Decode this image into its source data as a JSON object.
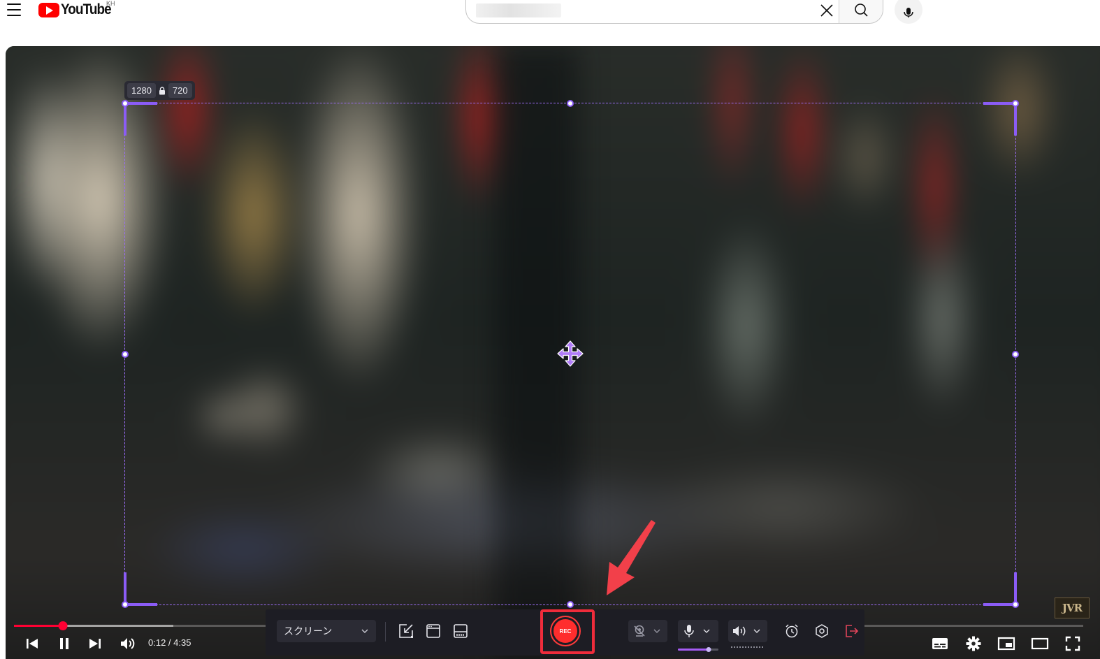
{
  "header": {
    "logo_text": "YouTube",
    "country_code": "KH",
    "search_value": "",
    "icons": [
      "menu-icon",
      "youtube-logo",
      "clear-icon",
      "search-icon",
      "mic-icon"
    ]
  },
  "capture": {
    "width_value": "1280",
    "height_value": "720",
    "lock_icon": "lock-icon",
    "move_icon": "move-icon"
  },
  "player": {
    "time": "0:12 / 4:35",
    "progress": {
      "played_percent": 4.6,
      "buffered_percent": 14.9
    },
    "controls": [
      "previous-icon",
      "pause-icon",
      "next-icon",
      "volume-icon",
      "subtitles-icon",
      "settings-icon",
      "miniplayer-icon",
      "theater-icon",
      "fullscreen-icon"
    ],
    "watermark": "JVR"
  },
  "recorder": {
    "mode": "スクリーン",
    "rec_label": "REC",
    "colors": {
      "toolbar": "#1d1d24",
      "rec": "#ff2d2d",
      "accent": "#8b5cf6",
      "highlight": "#ef2c3b",
      "exit": "#e0445a"
    },
    "mic_level_percent": 76,
    "icons": [
      "region-expand-icon",
      "window-icon",
      "scroll-capture-icon",
      "camera-off-icon",
      "microphone-icon",
      "speaker-icon",
      "alarm-clock-icon",
      "settings-hex-icon",
      "exit-icon"
    ]
  }
}
